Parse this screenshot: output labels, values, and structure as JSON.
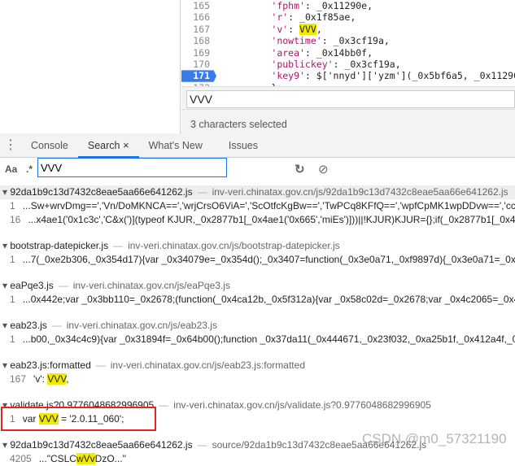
{
  "editor": {
    "lines": [
      {
        "n": "165",
        "key": "'fphm'",
        "val": ": _0x11290e,"
      },
      {
        "n": "166",
        "key": "'r'",
        "val": ": _0x1f85ae,"
      },
      {
        "n": "167",
        "key": "'v'",
        "sep": ": ",
        "hl": "VVV",
        "val": ","
      },
      {
        "n": "168",
        "key": "'nowtime'",
        "val": ": _0x3cf19a,"
      },
      {
        "n": "169",
        "key": "'area'",
        "val": ": _0x14bb0f,"
      },
      {
        "n": "170",
        "key": "'publickey'",
        "val": ": _0x3cf19a,"
      },
      {
        "n": "171",
        "key": "'key9'",
        "val": ": $['nnyd']['yzm'](_0x5bf6a5, _0x11290e, _"
      },
      {
        "n": "172",
        "key": "",
        "val": "};"
      }
    ],
    "find_value": "VVV",
    "status": "3 characters selected"
  },
  "drawer": {
    "tabs": [
      {
        "label": "Console"
      },
      {
        "label": "Search"
      },
      {
        "label": "What's New"
      },
      {
        "label": "Issues"
      }
    ],
    "close": "×"
  },
  "search": {
    "case_label": "Aa",
    "regex_label": ".*",
    "query": "VVV"
  },
  "results": [
    {
      "file": "92da1b9c13d7432c8eae5aa66e641262.js",
      "url": "inv-veri.chinatax.gov.cn/js/92da1b9c13d7432c8eae5aa66e641262.js",
      "lines": [
        {
          "n": "1",
          "pre": "...Sw+wrvDmg==','Vn/DoMKNCA==','wrjCrsO6ViA=','ScOtfcKgBw==','TwPCq8KFfQ==','wpfCpMK1wpDDvw==','cc",
          "hl": "",
          "post": ""
        },
        {
          "n": "16",
          "pre": "...x4ae1('0x1c3c','C&x(')](typeof KJUR,_0x2877b1[_0x4ae1('0x665','miEs')]))||!KJUR)KJUR={};if(_0x2877b1[_0x4ae1('0x",
          "hl": "",
          "post": ""
        }
      ]
    },
    {
      "file": "bootstrap-datepicker.js",
      "url": "inv-veri.chinatax.gov.cn/js/bootstrap-datepicker.js",
      "lines": [
        {
          "n": "1",
          "pre": "...7(_0xe2b306,_0x354d17){var _0x34079e=_0x354d();_0x3407=function(_0x3e0a71,_0xf9897d){_0x3e0a71=_0x3e0a7",
          "hl": "",
          "post": ""
        }
      ]
    },
    {
      "file": "eaPqe3.js",
      "url": "inv-veri.chinatax.gov.cn/js/eaPqe3.js",
      "lines": [
        {
          "n": "1",
          "pre": "...0x442e;var _0x3bb110=_0x2678;(function(_0x4ca12b,_0x5f312a){var _0x58c02d=_0x2678;var _0x4c2065=_0x442e;",
          "hl": "",
          "post": ""
        }
      ]
    },
    {
      "file": "eab23.js",
      "url": "inv-veri.chinatax.gov.cn/js/eab23.js",
      "lines": [
        {
          "n": "1",
          "pre": "...b00,_0x34c4c9){var _0x31894f=_0x64b00();function _0x37da11(_0x444671,_0x23f032,_0xa25b1f,_0x412a4f,_0x4a53",
          "hl": "",
          "post": ""
        }
      ]
    },
    {
      "file": "eab23.js:formatted",
      "url": "inv-veri.chinatax.gov.cn/js/eab23.js:formatted",
      "lines": [
        {
          "n": "167",
          "pre": "'v': ",
          "hl": "VVV",
          "post": ","
        }
      ]
    },
    {
      "file": "validate.js?0.9776048682996905",
      "url": "inv-veri.chinatax.gov.cn/js/validate.js?0.9776048682996905",
      "lines": [
        {
          "n": "1",
          "pre": "var ",
          "hl": "VVV",
          "post": " = '2.0.11_060';"
        }
      ]
    },
    {
      "file": "92da1b9c13d7432c8eae5aa66e641262.js",
      "url": "source/92da1b9c13d7432c8eae5aa66e641262.js",
      "lines": [
        {
          "n": "4205",
          "pre": "...\"CSLC",
          "hl": "wVv",
          "post": "DzO...\""
        }
      ]
    }
  ],
  "watermark": "CSDN @m0_57321190",
  "colors": {
    "accent": "#1a73e8",
    "highlight": "#f2ea00",
    "annotation": "#e8231f"
  }
}
